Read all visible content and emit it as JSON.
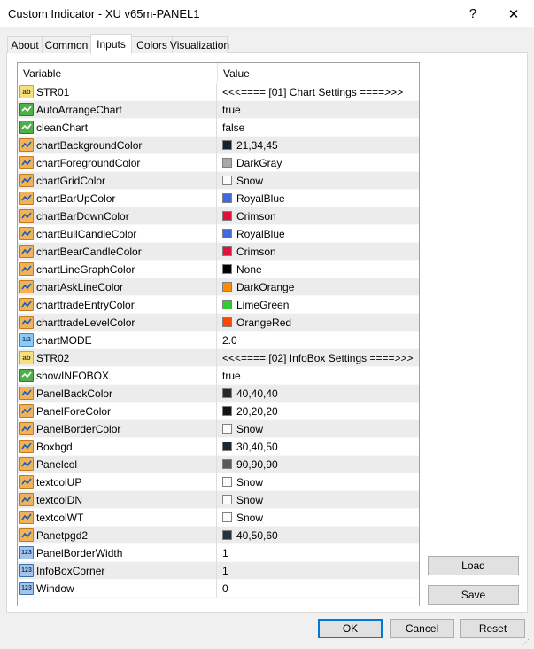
{
  "window": {
    "title": "Custom Indicator - XU v65m-PANEL1",
    "help_label": "?",
    "close_label": "✕"
  },
  "tabs": [
    {
      "label": "About"
    },
    {
      "label": "Common"
    },
    {
      "label": "Inputs"
    },
    {
      "label": "Colors"
    },
    {
      "label": "Visualization"
    }
  ],
  "active_tab": "Inputs",
  "grid": {
    "col_variable": "Variable",
    "col_value": "Value",
    "rows": [
      {
        "type": "ab",
        "name": "STR01",
        "value": "<<<==== [01] Chart Settings ====>>>"
      },
      {
        "type": "bool",
        "name": "AutoArrangeChart",
        "value": "true"
      },
      {
        "type": "bool",
        "name": "cleanChart",
        "value": "false"
      },
      {
        "type": "color",
        "name": "chartBackgroundColor",
        "value": "21,34,45",
        "color": "#15222d"
      },
      {
        "type": "color",
        "name": "chartForegroundColor",
        "value": "DarkGray",
        "color": "#a9a9a9"
      },
      {
        "type": "color",
        "name": "chartGridColor",
        "value": "Snow",
        "color": "#fffafa"
      },
      {
        "type": "color",
        "name": "chartBarUpColor",
        "value": "RoyalBlue",
        "color": "#4169e1"
      },
      {
        "type": "color",
        "name": "chartBarDownColor",
        "value": "Crimson",
        "color": "#dc143c"
      },
      {
        "type": "color",
        "name": "chartBullCandleColor",
        "value": "RoyalBlue",
        "color": "#4169e1"
      },
      {
        "type": "color",
        "name": "chartBearCandleColor",
        "value": "Crimson",
        "color": "#dc143c"
      },
      {
        "type": "color",
        "name": "chartLineGraphColor",
        "value": "None",
        "color": "#000000"
      },
      {
        "type": "color",
        "name": "chartAskLineColor",
        "value": "DarkOrange",
        "color": "#ff8c00"
      },
      {
        "type": "color",
        "name": "charttradeEntryColor",
        "value": "LimeGreen",
        "color": "#32cd32"
      },
      {
        "type": "color",
        "name": "charttradeLevelColor",
        "value": "OrangeRed",
        "color": "#ff4500"
      },
      {
        "type": "double",
        "name": "chartMODE",
        "value": "2.0"
      },
      {
        "type": "ab",
        "name": "STR02",
        "value": "<<<==== [02] InfoBox Settings ====>>>"
      },
      {
        "type": "bool",
        "name": "showINFOBOX",
        "value": "true"
      },
      {
        "type": "color",
        "name": "PanelBackColor",
        "value": "40,40,40",
        "color": "#282828"
      },
      {
        "type": "color",
        "name": "PanelForeColor",
        "value": "20,20,20",
        "color": "#141414"
      },
      {
        "type": "color",
        "name": "PanelBorderColor",
        "value": "Snow",
        "color": "#fffafa"
      },
      {
        "type": "color",
        "name": "Boxbgd",
        "value": "30,40,50",
        "color": "#1e2832"
      },
      {
        "type": "color",
        "name": "Panelcol",
        "value": "90,90,90",
        "color": "#5a5a5a"
      },
      {
        "type": "color",
        "name": "textcolUP",
        "value": "Snow",
        "color": "#fffafa"
      },
      {
        "type": "color",
        "name": "textcolDN",
        "value": "Snow",
        "color": "#fffafa"
      },
      {
        "type": "color",
        "name": "textcolWT",
        "value": "Snow",
        "color": "#fffafa"
      },
      {
        "type": "color",
        "name": "Panetpgd2",
        "value": "40,50,60",
        "color": "#28323c"
      },
      {
        "type": "int",
        "name": "PanelBorderWidth",
        "value": "1"
      },
      {
        "type": "int",
        "name": "InfoBoxCorner",
        "value": "1"
      },
      {
        "type": "int",
        "name": "Window",
        "value": "0"
      }
    ]
  },
  "buttons": {
    "load": "Load",
    "save": "Save",
    "ok": "OK",
    "cancel": "Cancel",
    "reset": "Reset"
  },
  "icons": {
    "ab": "ab",
    "double": "1/2",
    "int": "123"
  }
}
